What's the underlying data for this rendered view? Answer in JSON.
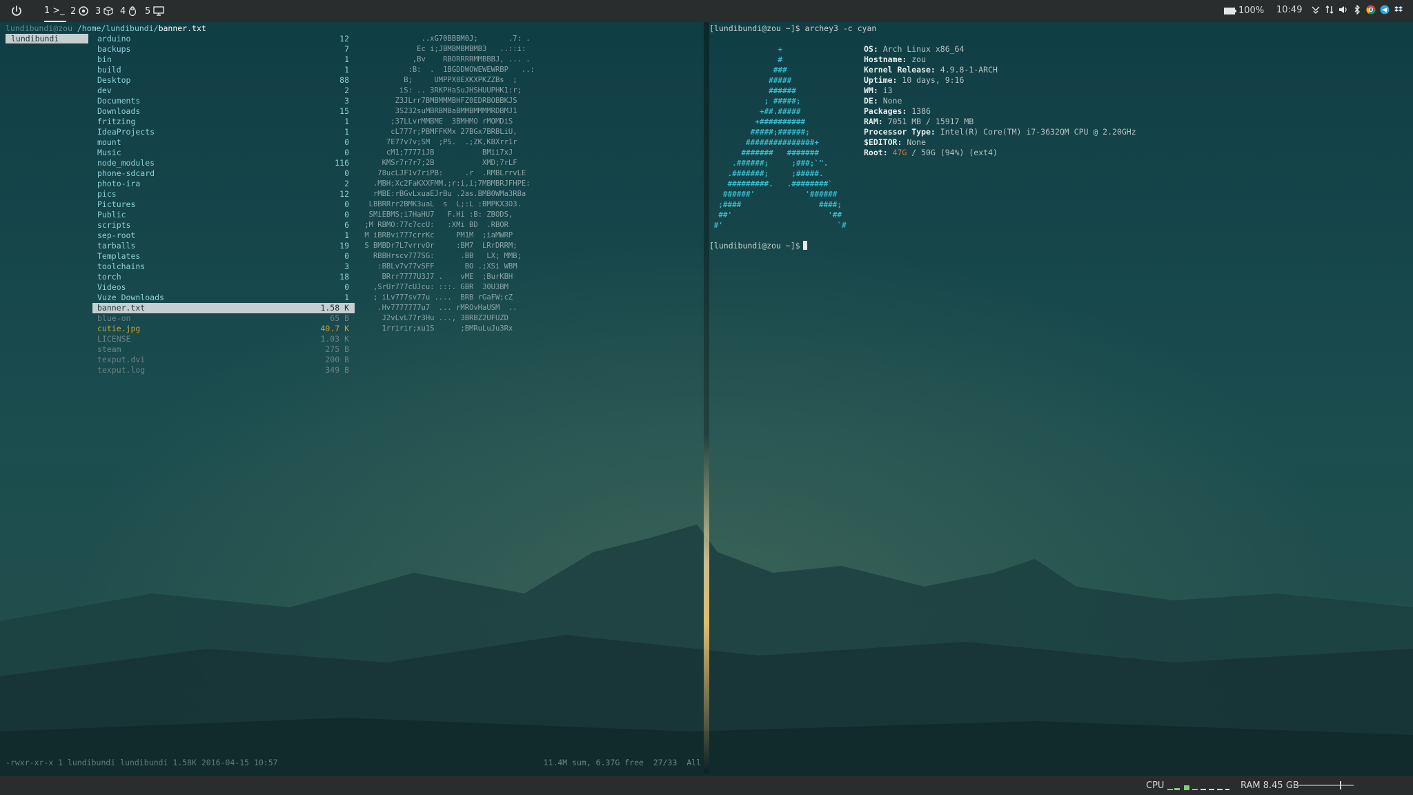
{
  "topbar": {
    "workspaces": [
      {
        "num": "1",
        "icon": "terminal-icon",
        "glyph": ">_",
        "active": true
      },
      {
        "num": "2",
        "icon": "chrome-icon"
      },
      {
        "num": "3",
        "icon": "cube-icon"
      },
      {
        "num": "4",
        "icon": "tux-icon"
      },
      {
        "num": "5",
        "icon": "monitor-icon"
      }
    ],
    "battery": "100%",
    "clock": "10:49",
    "tray_icons": [
      "network-icon",
      "updown-icon",
      "volume-icon",
      "bluetooth-icon",
      "chrome-icon",
      "telegram-icon",
      "dropbox-icon"
    ]
  },
  "bottombar": {
    "cpu_label": "CPU",
    "ram_label": "RAM 8.45 GB",
    "ram_fraction": 0.76
  },
  "ranger": {
    "host": "lundibundi@zou",
    "path_dir": " /home/lundibundi/",
    "path_file": "banner.txt",
    "parent": "lundibundi",
    "entries": [
      {
        "name": "arduino",
        "size": "12",
        "kind": "dir"
      },
      {
        "name": "backups",
        "size": "7",
        "kind": "dir"
      },
      {
        "name": "bin",
        "size": "1",
        "kind": "dir"
      },
      {
        "name": "build",
        "size": "1",
        "kind": "dir"
      },
      {
        "name": "Desktop",
        "size": "88",
        "kind": "dir"
      },
      {
        "name": "dev",
        "size": "2",
        "kind": "dir"
      },
      {
        "name": "Documents",
        "size": "3",
        "kind": "dir"
      },
      {
        "name": "Downloads",
        "size": "15",
        "kind": "dir"
      },
      {
        "name": "fritzing",
        "size": "1",
        "kind": "dir"
      },
      {
        "name": "IdeaProjects",
        "size": "1",
        "kind": "dir"
      },
      {
        "name": "mount",
        "size": "0",
        "kind": "dir"
      },
      {
        "name": "Music",
        "size": "0",
        "kind": "dir"
      },
      {
        "name": "node_modules",
        "size": "116",
        "kind": "dir"
      },
      {
        "name": "phone-sdcard",
        "size": "0",
        "kind": "dir"
      },
      {
        "name": "photo-ira",
        "size": "2",
        "kind": "dir"
      },
      {
        "name": "pics",
        "size": "12",
        "kind": "dir"
      },
      {
        "name": "Pictures",
        "size": "0",
        "kind": "dir"
      },
      {
        "name": "Public",
        "size": "0",
        "kind": "dir"
      },
      {
        "name": "scripts",
        "size": "6",
        "kind": "dir"
      },
      {
        "name": "sep-root",
        "size": "1",
        "kind": "dir"
      },
      {
        "name": "tarballs",
        "size": "19",
        "kind": "dir"
      },
      {
        "name": "Templates",
        "size": "0",
        "kind": "dir"
      },
      {
        "name": "toolchains",
        "size": "3",
        "kind": "dir"
      },
      {
        "name": "torch",
        "size": "18",
        "kind": "dir"
      },
      {
        "name": "Videos",
        "size": "0",
        "kind": "dir"
      },
      {
        "name": "Vuze Downloads",
        "size": "1",
        "kind": "dir"
      },
      {
        "name": "banner.txt",
        "size": "1.58 K",
        "kind": "file",
        "selected": true
      },
      {
        "name": "blue-on",
        "size": "65 B",
        "kind": "file",
        "style": "dim"
      },
      {
        "name": "cutie.jpg",
        "size": "40.7 K",
        "kind": "file",
        "style": "img"
      },
      {
        "name": "LICENSE",
        "size": "1.03 K",
        "kind": "file",
        "style": "dim"
      },
      {
        "name": "steam",
        "size": "275 B",
        "kind": "file",
        "style": "dim"
      },
      {
        "name": "texput.dvi",
        "size": "200 B",
        "kind": "file",
        "style": "dim"
      },
      {
        "name": "texput.log",
        "size": "349 B",
        "kind": "file",
        "style": "dim"
      }
    ],
    "preview": [
      "              ..xG70BBBM0J;       .7: .",
      "             Ec i;JBMBMBMBMB3   ..::i:",
      "            ,Bv    RBORRRRMMBBBJ, ... .",
      "           :B:  .  1BGDDWOWEWEWRBP   ..:",
      "          B;     UMPPX0EXKXPKZZBs  ;",
      "         iS: .. 3RKPHaSuJHSHUUPHK1:r;",
      "        Z3JLrr7BMBMMMBHFZ0EDRBOBBKJS",
      "        3S232suMBRBMBaBMMBMMMMRDBMJ1",
      "       ;37LLvrMMBME  3BMHMO rMOMDiS",
      "       cL777r;PBMFFKMx 27BGx7BRBLiU,",
      "      7E77v7v;SM  ;PS.  .;ZK,KBXrr1r",
      "      cM1;7777iJB           BMii7xJ",
      "     KMSr7r7r7;2B           XMD;7rLF",
      "    78ucLJF1v7riPB:     .r  .RMBLrrvLE",
      "   .MBH;Xc2FaKXXFMM.;r:i,i;7MBMBRJFHPE:",
      "   rMBE:rBGvLxuaEJrBu .2as.BMB0WMa3RBa",
      "  LBBRRrr2BMK3uaL  s  L;:L :BMPKX3O3.",
      "  SMiEBMS;i7HaHU7   F.Hi :B: ZBODS,",
      " ;M RBMO:77c7ccU:   :XMi BD  .RBOR",
      " M iBRBvi777crrKc     PM1M  ;iaMWRP",
      " S BMBDr7L7vrrvOr     :BM7  LRrDRRM;",
      "   RBBHrscv777SG:      .BB   LX; MMB;",
      "    :BBLv7v77vSFF       BO .;XSi WBM",
      "     BRrr7777U3J7 .    vME  ;BurKBH",
      "   ,SrUr777cUJcu: :::. GBR  30U3BM",
      "   ; iLv777sv77u ....  BRB rGaFW;cZ",
      "    .Hv7777777u7  ... rMROvHaUSM  ..",
      "     J2vLvL77r3Hu ..., 3BRBZ2UFUZD",
      "     1rririr;xu1S      ;BMRuLuJu3Rx"
    ],
    "status_left": "-rwxr-xr-x 1 lundibundi lundibundi 1.58K 2016-04-15 10:57",
    "status_right": "11.4M sum, 6.37G free  27/33  All"
  },
  "archey": {
    "prompt1": "[lundibundi@zou ~]$ archey3 -c cyan",
    "ascii": [
      "               +",
      "               #",
      "              ###",
      "             #####",
      "             ######",
      "            ; #####;",
      "           +##.#####",
      "          +##########",
      "         #####;######;",
      "        ###############+",
      "       #######   #######",
      "     .######;     ;###;`\".",
      "    .#######;     ;#####.",
      "    #########.   .########`",
      "   ######'           '######",
      "  ;####                 ####;",
      "  ##'                     '##",
      " #'                         `#"
    ],
    "info": [
      {
        "key": "OS:",
        "val": " Arch Linux x86_64"
      },
      {
        "key": "Hostname:",
        "val": " zou"
      },
      {
        "key": "Kernel Release:",
        "val": " 4.9.8-1-ARCH"
      },
      {
        "key": "Uptime:",
        "val": " 10 days, 9:16"
      },
      {
        "key": "WM:",
        "val": " i3"
      },
      {
        "key": "DE:",
        "val": " None"
      },
      {
        "key": "Packages:",
        "val": " 1386"
      },
      {
        "key": "RAM:",
        "val": " 7051 MB / 15917 MB"
      },
      {
        "key": "Processor Type:",
        "val": " Intel(R) Core(TM) i7-3632QM CPU @ 2.20GHz"
      },
      {
        "key": "$EDITOR:",
        "val": " None"
      },
      {
        "key": "Root:",
        "val_used": "47G",
        "val": " / 50G (94%) (ext4)"
      }
    ],
    "prompt2": "[lundibundi@zou ~]$",
    "colors": {
      "ascii": "#36b9c8",
      "root_used": "#e86c3a"
    }
  }
}
